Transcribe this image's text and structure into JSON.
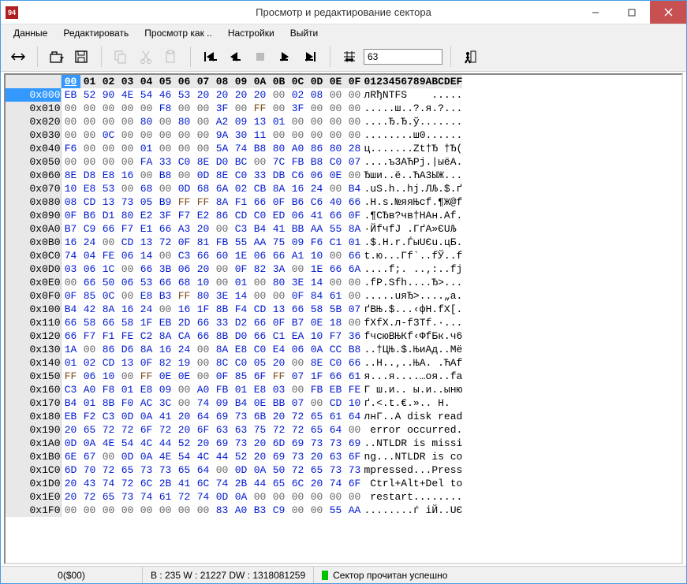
{
  "window": {
    "title": "Просмотр и редактирование сектора"
  },
  "menu": {
    "items": [
      {
        "label": "Данные"
      },
      {
        "label": "Редактировать"
      },
      {
        "label": "Просмотр как .."
      },
      {
        "label": "Настройки"
      },
      {
        "label": "Выйти"
      }
    ]
  },
  "toolbar": {
    "goto_value": "63"
  },
  "header": {
    "cols": [
      "00",
      "01",
      "02",
      "03",
      "04",
      "05",
      "06",
      "07",
      "08",
      "09",
      "0A",
      "0B",
      "0C",
      "0D",
      "0E",
      "0F"
    ],
    "sel_col": 0,
    "ascii": "0123456789ABCDEF"
  },
  "rows": [
    {
      "off": "0x000",
      "sel": true,
      "hex": [
        "EB",
        "52",
        "90",
        "4E",
        "54",
        "46",
        "53",
        "20",
        "20",
        "20",
        "20",
        "00",
        "02",
        "08",
        "00",
        "00"
      ],
      "ascii": "лRђNTFS    ....."
    },
    {
      "off": "0x010",
      "hex": [
        "00",
        "00",
        "00",
        "00",
        "00",
        "F8",
        "00",
        "00",
        "3F",
        "00",
        "FF",
        "00",
        "3F",
        "00",
        "00",
        "00"
      ],
      "ascii": ".....ш..?.я.?..."
    },
    {
      "off": "0x020",
      "hex": [
        "00",
        "00",
        "00",
        "00",
        "80",
        "00",
        "80",
        "00",
        "A2",
        "09",
        "13",
        "01",
        "00",
        "00",
        "00",
        "00"
      ],
      "ascii": "....Ђ.Ђ.ў......."
    },
    {
      "off": "0x030",
      "hex": [
        "00",
        "00",
        "0C",
        "00",
        "00",
        "00",
        "00",
        "00",
        "9A",
        "30",
        "11",
        "00",
        "00",
        "00",
        "00",
        "00"
      ],
      "ascii": "........ш0......"
    },
    {
      "off": "0x040",
      "hex": [
        "F6",
        "00",
        "00",
        "00",
        "01",
        "00",
        "00",
        "00",
        "5A",
        "74",
        "B8",
        "80",
        "A0",
        "86",
        "80",
        "28"
      ],
      "ascii": "ц.......Zt†Ђ †Ђ("
    },
    {
      "off": "0x050",
      "hex": [
        "00",
        "00",
        "00",
        "00",
        "FA",
        "33",
        "C0",
        "8E",
        "D0",
        "BC",
        "00",
        "7C",
        "FB",
        "B8",
        "C0",
        "07"
      ],
      "ascii": "....ъ3АЋРј.|ыёА."
    },
    {
      "off": "0x060",
      "hex": [
        "8E",
        "D8",
        "E8",
        "16",
        "00",
        "B8",
        "00",
        "0D",
        "8E",
        "C0",
        "33",
        "DB",
        "C6",
        "06",
        "0E",
        "00"
      ],
      "ascii": "Ђши..ё..ЋА3ЫЖ..."
    },
    {
      "off": "0x070",
      "hex": [
        "10",
        "E8",
        "53",
        "00",
        "68",
        "00",
        "0D",
        "68",
        "6A",
        "02",
        "CB",
        "8A",
        "16",
        "24",
        "00",
        "B4"
      ],
      "ascii": ".uS.h..hj.ЛЉ.$.ґ"
    },
    {
      "off": "0x080",
      "hex": [
        "08",
        "CD",
        "13",
        "73",
        "05",
        "B9",
        "FF",
        "FF",
        "8A",
        "F1",
        "66",
        "0F",
        "B6",
        "C6",
        "40",
        "66"
      ],
      "ascii": ".Н.s.№яяЊсf.¶Ж@f"
    },
    {
      "off": "0x090",
      "hex": [
        "0F",
        "B6",
        "D1",
        "80",
        "E2",
        "3F",
        "F7",
        "E2",
        "86",
        "CD",
        "C0",
        "ED",
        "06",
        "41",
        "66",
        "0F"
      ],
      "ascii": ".¶СЂв?чв†НАн.Af."
    },
    {
      "off": "0x0A0",
      "hex": [
        "B7",
        "C9",
        "66",
        "F7",
        "E1",
        "66",
        "A3",
        "20",
        "00",
        "C3",
        "B4",
        "41",
        "BB",
        "AA",
        "55",
        "8A"
      ],
      "ascii": "·Йfч­fЈ .ГґА»ЄUЉ"
    },
    {
      "off": "0x0B0",
      "hex": [
        "16",
        "24",
        "00",
        "CD",
        "13",
        "72",
        "0F",
        "81",
        "FB",
        "55",
        "AA",
        "75",
        "09",
        "F6",
        "C1",
        "01"
      ],
      "ascii": ".$.Н.r.ЃыUЄu.цБ."
    },
    {
      "off": "0x0C0",
      "hex": [
        "74",
        "04",
        "FE",
        "06",
        "14",
        "00",
        "C3",
        "66",
        "60",
        "1E",
        "06",
        "66",
        "A1",
        "10",
        "00",
        "66"
      ],
      "ascii": "t.ю...Гf`..fЎ..f"
    },
    {
      "off": "0x0D0",
      "hex": [
        "03",
        "06",
        "1C",
        "00",
        "66",
        "3B",
        "06",
        "20",
        "00",
        "0F",
        "82",
        "3A",
        "00",
        "1E",
        "66",
        "6A"
      ],
      "ascii": "....f;. ..‚:..fj"
    },
    {
      "off": "0x0E0",
      "hex": [
        "00",
        "66",
        "50",
        "06",
        "53",
        "66",
        "68",
        "10",
        "00",
        "01",
        "00",
        "80",
        "3E",
        "14",
        "00",
        "00"
      ],
      "ascii": ".fP.Sfh....Ђ>..."
    },
    {
      "off": "0x0F0",
      "hex": [
        "0F",
        "85",
        "0C",
        "00",
        "E8",
        "B3",
        "FF",
        "80",
        "3E",
        "14",
        "00",
        "00",
        "0F",
        "84",
        "61",
        "00"
      ],
      "ascii": ".....uяЂ>....„a."
    },
    {
      "off": "0x100",
      "hex": [
        "B4",
        "42",
        "8A",
        "16",
        "24",
        "00",
        "16",
        "1F",
        "8B",
        "F4",
        "CD",
        "13",
        "66",
        "58",
        "5B",
        "07"
      ],
      "ascii": "ґBЊ.$...‹фН.fX[."
    },
    {
      "off": "0x110",
      "hex": [
        "66",
        "58",
        "66",
        "58",
        "1F",
        "EB",
        "2D",
        "66",
        "33",
        "D2",
        "66",
        "0F",
        "B7",
        "0E",
        "18",
        "00"
      ],
      "ascii": "fXfX.л-f3Тf.·..."
    },
    {
      "off": "0x120",
      "hex": [
        "66",
        "F7",
        "F1",
        "FE",
        "C2",
        "8A",
        "CA",
        "66",
        "8B",
        "D0",
        "66",
        "C1",
        "EA",
        "10",
        "F7",
        "36"
      ],
      "ascii": "fчсюВЊКf‹ФfБк.ч6"
    },
    {
      "off": "0x130",
      "hex": [
        "1A",
        "00",
        "86",
        "D6",
        "8A",
        "16",
        "24",
        "00",
        "8A",
        "E8",
        "C0",
        "E4",
        "06",
        "0A",
        "CC",
        "B8"
      ],
      "ascii": "..†ЦЊ.$.ЊиАд..Мё"
    },
    {
      "off": "0x140",
      "hex": [
        "01",
        "02",
        "CD",
        "13",
        "0F",
        "82",
        "19",
        "00",
        "8C",
        "C0",
        "05",
        "20",
        "00",
        "8E",
        "C0",
        "66"
      ],
      "ascii": "..Н..‚..ЊА. .ЋАf"
    },
    {
      "off": "0x150",
      "hex": [
        "FF",
        "06",
        "10",
        "00",
        "FF",
        "0E",
        "0E",
        "00",
        "0F",
        "85",
        "6F",
        "FF",
        "07",
        "1F",
        "66",
        "61"
      ],
      "ascii": "я...я....…oя..fa"
    },
    {
      "off": "0x160",
      "hex": [
        "C3",
        "A0",
        "F8",
        "01",
        "E8",
        "09",
        "00",
        "A0",
        "FB",
        "01",
        "E8",
        "03",
        "00",
        "FB",
        "EB",
        "FE"
      ],
      "ascii": "Г ш.и.. ы.и..ыню"
    },
    {
      "off": "0x170",
      "hex": [
        "B4",
        "01",
        "8B",
        "F0",
        "AC",
        "3C",
        "00",
        "74",
        "09",
        "B4",
        "0E",
        "BB",
        "07",
        "00",
        "CD",
        "10"
      ],
      "ascii": "ґ.<.t.€.».. Н."
    },
    {
      "off": "0x180",
      "hex": [
        "EB",
        "F2",
        "C3",
        "0D",
        "0A",
        "41",
        "20",
        "64",
        "69",
        "73",
        "6B",
        "20",
        "72",
        "65",
        "61",
        "64"
      ],
      "ascii": "лнГ..A disk read"
    },
    {
      "off": "0x190",
      "hex": [
        "20",
        "65",
        "72",
        "72",
        "6F",
        "72",
        "20",
        "6F",
        "63",
        "63",
        "75",
        "72",
        "72",
        "65",
        "64",
        "00"
      ],
      "ascii": " error occurred."
    },
    {
      "off": "0x1A0",
      "hex": [
        "0D",
        "0A",
        "4E",
        "54",
        "4C",
        "44",
        "52",
        "20",
        "69",
        "73",
        "20",
        "6D",
        "69",
        "73",
        "73",
        "69"
      ],
      "ascii": "..NTLDR is missi"
    },
    {
      "off": "0x1B0",
      "hex": [
        "6E",
        "67",
        "00",
        "0D",
        "0A",
        "4E",
        "54",
        "4C",
        "44",
        "52",
        "20",
        "69",
        "73",
        "20",
        "63",
        "6F"
      ],
      "ascii": "ng...NTLDR is co"
    },
    {
      "off": "0x1C0",
      "hex": [
        "6D",
        "70",
        "72",
        "65",
        "73",
        "73",
        "65",
        "64",
        "00",
        "0D",
        "0A",
        "50",
        "72",
        "65",
        "73",
        "73"
      ],
      "ascii": "mpressed...Press"
    },
    {
      "off": "0x1D0",
      "hex": [
        "20",
        "43",
        "74",
        "72",
        "6C",
        "2B",
        "41",
        "6C",
        "74",
        "2B",
        "44",
        "65",
        "6C",
        "20",
        "74",
        "6F"
      ],
      "ascii": " Ctrl+Alt+Del to"
    },
    {
      "off": "0x1E0",
      "hex": [
        "20",
        "72",
        "65",
        "73",
        "74",
        "61",
        "72",
        "74",
        "0D",
        "0A",
        "00",
        "00",
        "00",
        "00",
        "00",
        "00"
      ],
      "ascii": " restart........"
    },
    {
      "off": "0x1F0",
      "hex": [
        "00",
        "00",
        "00",
        "00",
        "00",
        "00",
        "00",
        "00",
        "83",
        "A0",
        "B3",
        "C9",
        "00",
        "00",
        "55",
        "AA"
      ],
      "ascii": "........ѓ іЙ..UЄ"
    }
  ],
  "status": {
    "seg1": "0($00)",
    "seg2": "B : 235 W : 21227 DW : 1318081259",
    "seg3": "Сектор прочитан успешно"
  }
}
